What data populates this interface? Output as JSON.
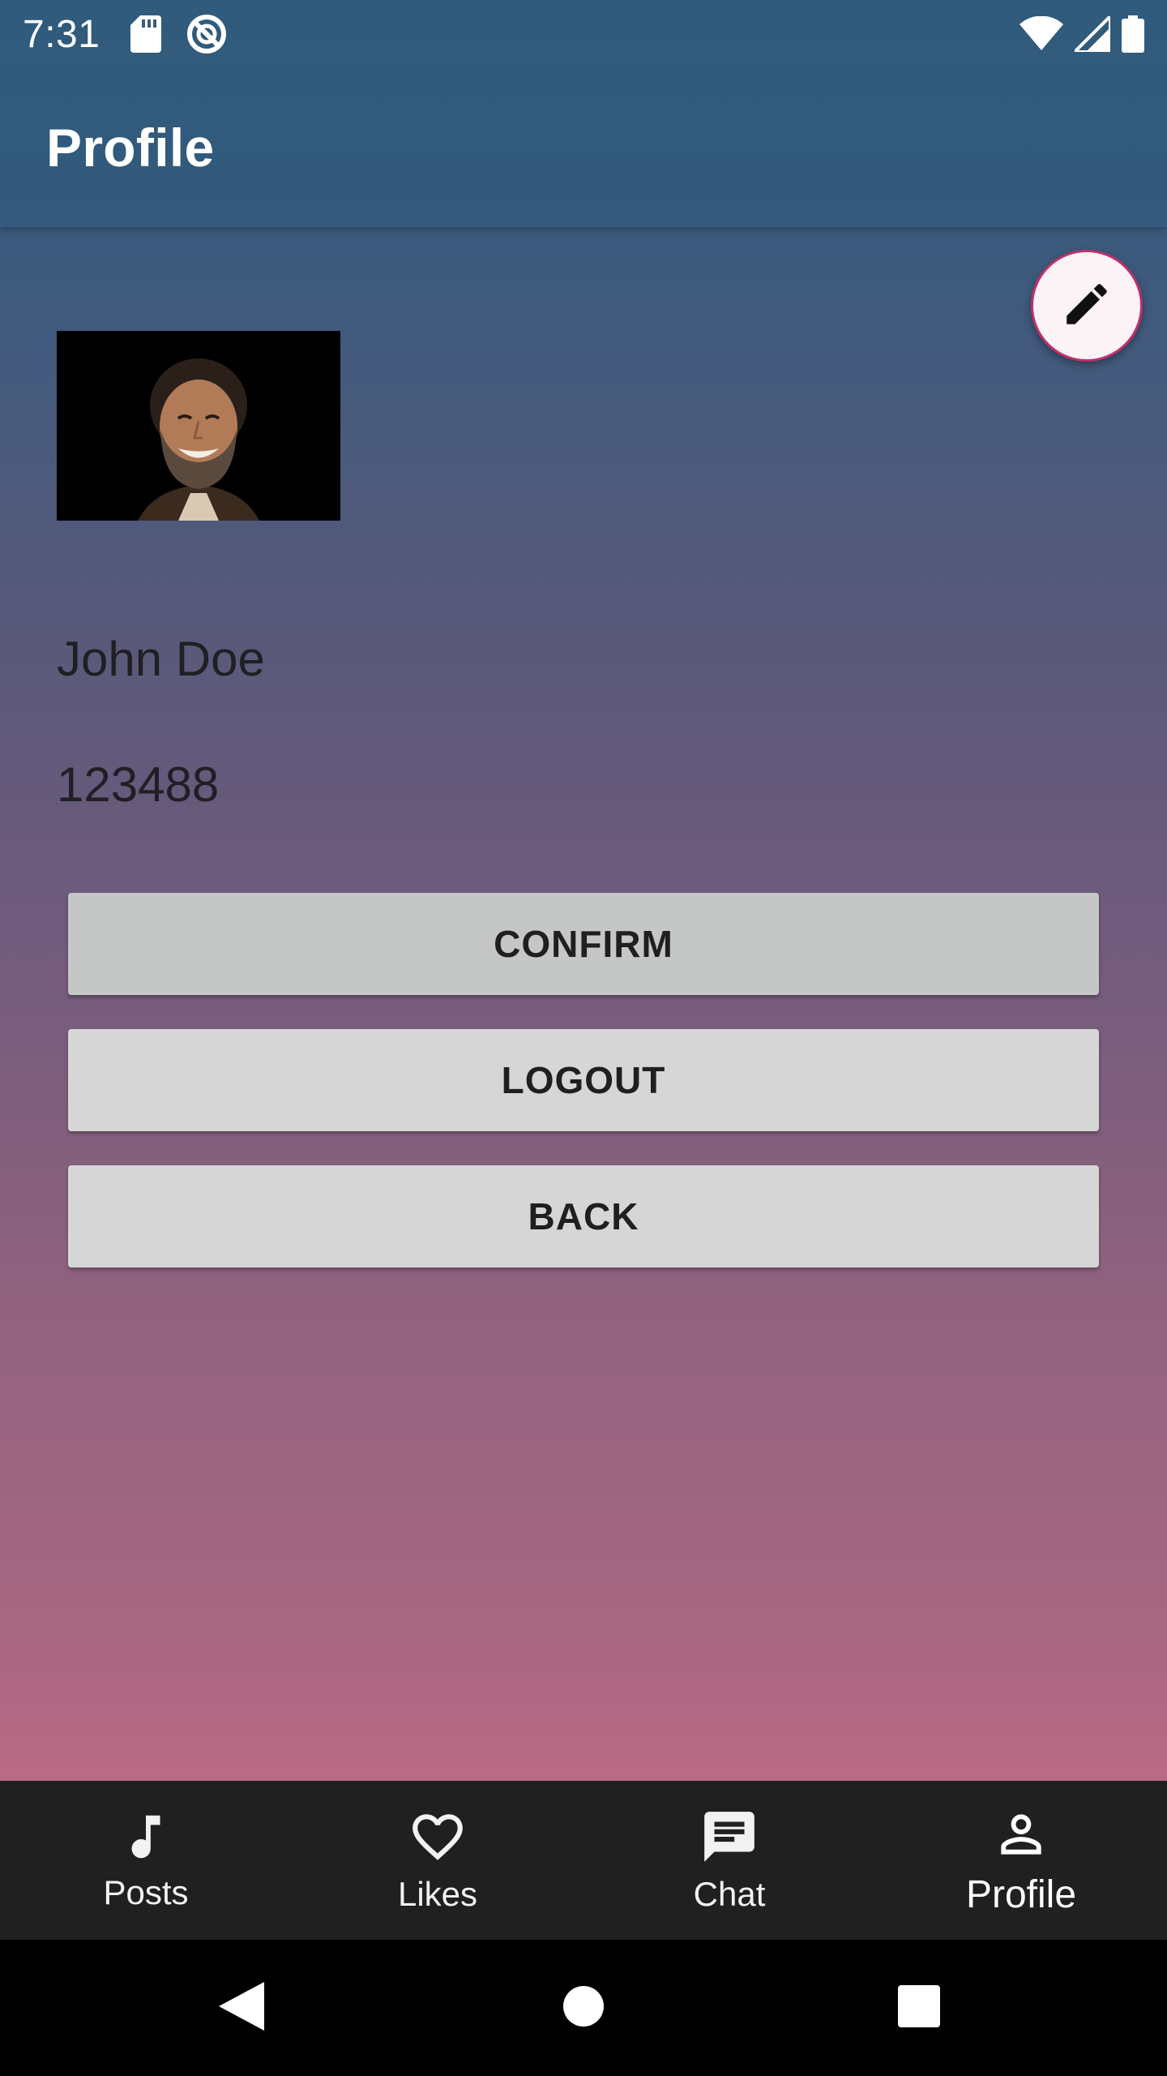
{
  "status_bar": {
    "time": "7:31",
    "icons": [
      "sd-card-icon",
      "sync-disabled-icon",
      "wifi-icon",
      "signal-icon",
      "battery-icon"
    ]
  },
  "app_bar": {
    "title": "Profile"
  },
  "fab": {
    "icon": "pencil-icon"
  },
  "profile": {
    "name": "John Doe",
    "id": "123488"
  },
  "buttons": {
    "confirm": "CONFIRM",
    "logout": "LOGOUT",
    "back": "BACK"
  },
  "bottom_nav": {
    "items": [
      {
        "label": "Posts",
        "icon": "music-note-icon"
      },
      {
        "label": "Likes",
        "icon": "heart-icon"
      },
      {
        "label": "Chat",
        "icon": "chat-icon"
      },
      {
        "label": "Profile",
        "icon": "person-icon",
        "active": true
      }
    ]
  },
  "system_nav": {
    "icons": [
      "back-icon",
      "home-icon",
      "recents-icon"
    ]
  },
  "colors": {
    "gradient_top": "#2f5b7c",
    "gradient_bottom": "#bb6a84",
    "button_bg": "#d6d6d6",
    "nav_bg": "#202020",
    "fab_border": "#c1306a"
  }
}
